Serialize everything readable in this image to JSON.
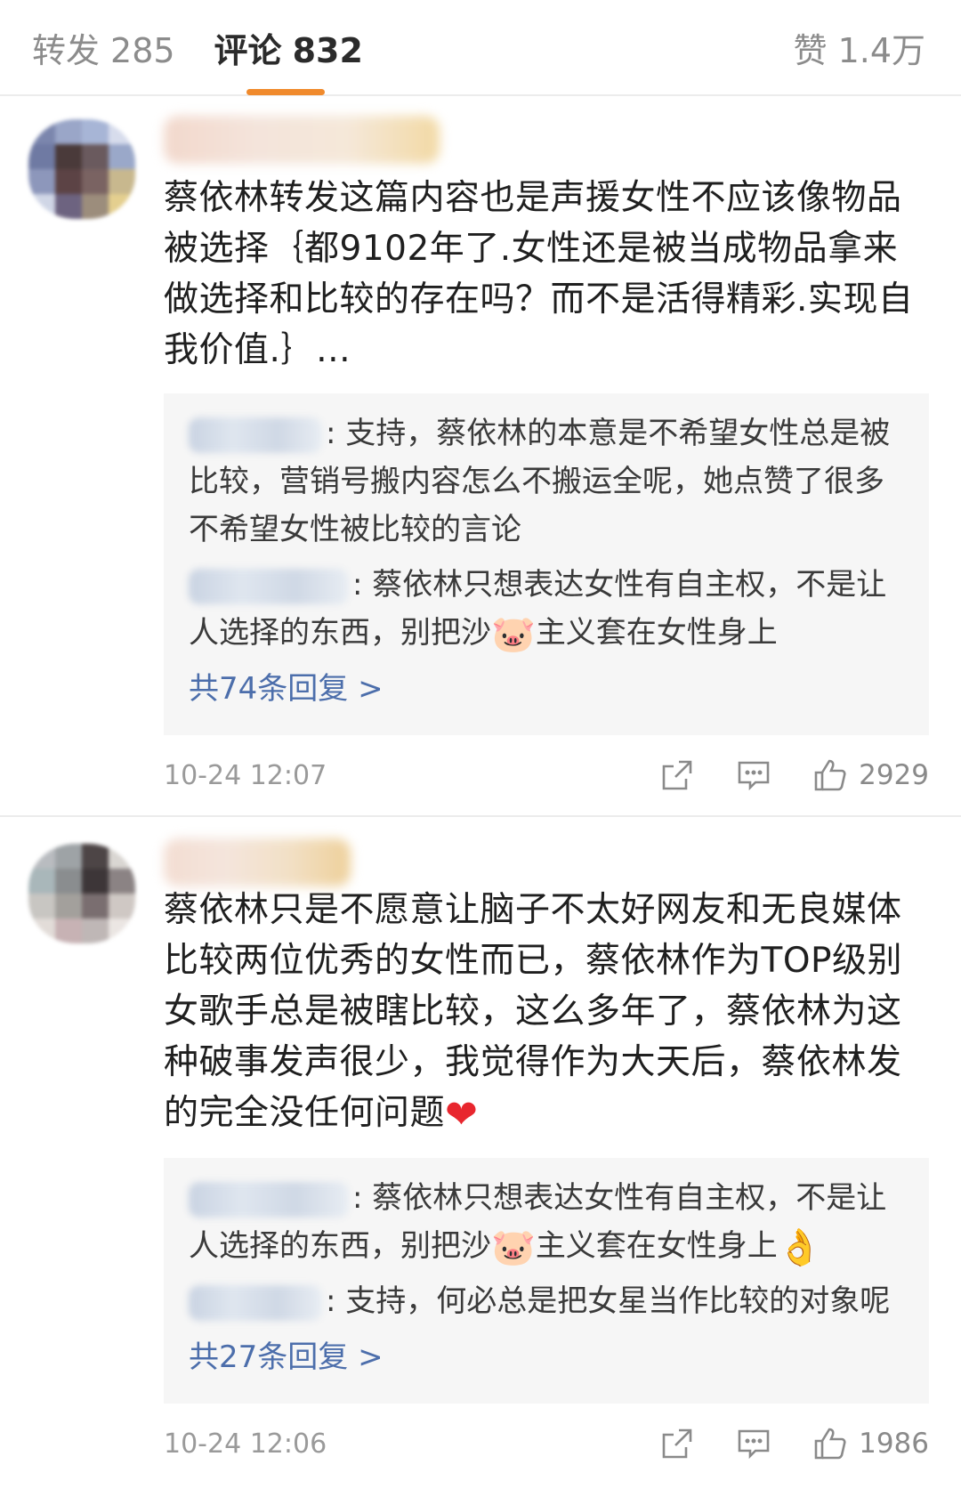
{
  "tabs": {
    "repost_label": "转发",
    "repost_count": "285",
    "comment_label": "评论",
    "comment_count": "832",
    "like_label": "赞",
    "like_count": "1.4万"
  },
  "comments": [
    {
      "text": "蔡依林转发这篇内容也是声援女性不应该像物品被选择｛都9102年了.女性还是被当成物品拿来做选择和比较的存在吗？而不是活得精彩.实现自我价值.｝…",
      "replies": [
        {
          "text": ": 支持，蔡依林的本意是不希望女性总是被比较，营销号搬内容怎么不搬运全呢，她点赞了很多不希望女性被比较的言论"
        },
        {
          "text_before": ": 蔡依林只想表达女性有自主权，不是让人选择的东西，别把沙",
          "emoji": "🐷",
          "text_after": "主义套在女性身上"
        }
      ],
      "more_replies": "共74条回复 >",
      "time": "10-24 12:07",
      "likes": "2929"
    },
    {
      "text": "蔡依林只是不愿意让脑子不太好网友和无良媒体比较两位优秀的女性而已，蔡依林作为TOP级别女歌手总是被瞎比较，这么多年了，蔡依林为这种破事发声很少，我觉得作为大天后，蔡依林发的完全没任何问题",
      "heart": "❤",
      "replies": [
        {
          "text_before": ": 蔡依林只想表达女性有自主权，不是让人选择的东西，别把沙",
          "emoji": "🐷",
          "text_after": "主义套在女性身上",
          "trail": "👌"
        },
        {
          "text": ": 支持，何必总是把女星当作比较的对象呢"
        }
      ],
      "more_replies": "共27条回复 >",
      "time": "10-24 12:06",
      "likes": "1986"
    }
  ]
}
